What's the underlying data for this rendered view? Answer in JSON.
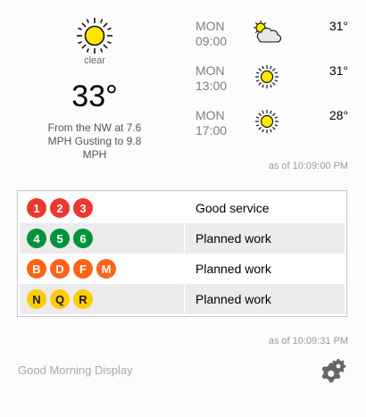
{
  "current": {
    "icon": "sun-icon",
    "condition": "clear",
    "temperature": "33°",
    "wind_lines": [
      "From the NW at 7.6",
      "MPH Gusting to 9.8",
      "MPH"
    ]
  },
  "forecast": [
    {
      "day": "MON",
      "time": "09:00",
      "icon": "partly-cloudy-icon",
      "temp": "31°"
    },
    {
      "day": "MON",
      "time": "13:00",
      "icon": "sun-icon",
      "temp": "31°"
    },
    {
      "day": "MON",
      "time": "17:00",
      "icon": "sun-icon",
      "temp": "28°"
    }
  ],
  "weather_as_of": "as of 10:09:00 PM",
  "subway": [
    {
      "lines": [
        "1",
        "2",
        "3"
      ],
      "color": "#EE352E",
      "dark_text": false,
      "status": "Good service"
    },
    {
      "lines": [
        "4",
        "5",
        "6"
      ],
      "color": "#00933C",
      "dark_text": false,
      "status": "Planned work"
    },
    {
      "lines": [
        "B",
        "D",
        "F",
        "M"
      ],
      "color": "#FF6319",
      "dark_text": false,
      "status": "Planned work"
    },
    {
      "lines": [
        "N",
        "Q",
        "R"
      ],
      "color": "#FCCC0A",
      "dark_text": true,
      "status": "Planned work"
    }
  ],
  "subway_as_of": "as of 10:09:31 PM",
  "footer": {
    "title": "Good Morning Display",
    "settings_icon": "gear-icon"
  }
}
